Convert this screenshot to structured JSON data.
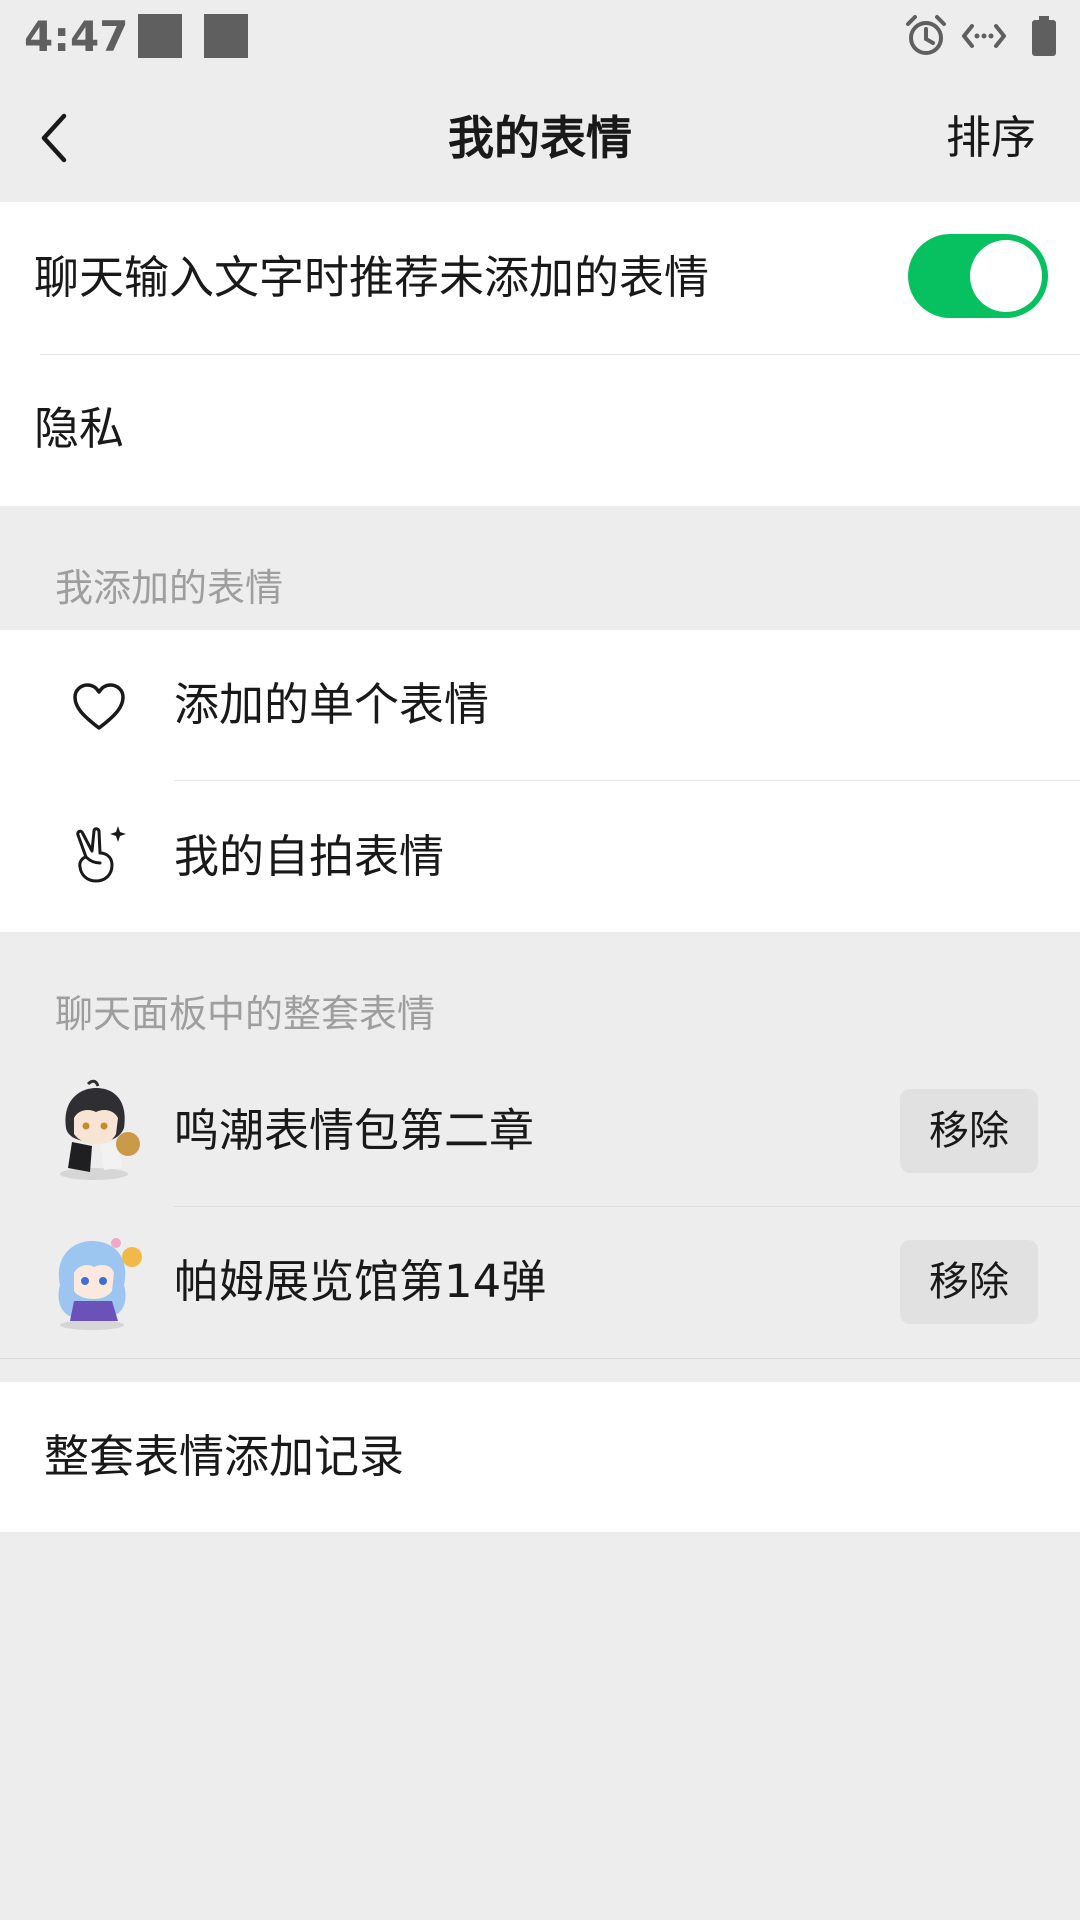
{
  "status_bar": {
    "time": "4:47",
    "icons": [
      "notification-square-icon",
      "notification-square-icon",
      "alarm-icon",
      "data-transfer-icon",
      "battery-icon"
    ]
  },
  "nav": {
    "back_icon": "chevron-left-icon",
    "title": "我的表情",
    "sort_label": "排序"
  },
  "settings": {
    "recommend_label": "聊天输入文字时推荐未添加的表情",
    "recommend_enabled": true,
    "privacy_label": "隐私"
  },
  "added_section": {
    "title": "我添加的表情",
    "items": [
      {
        "icon": "heart-icon",
        "label": "添加的单个表情"
      },
      {
        "icon": "victory-hand-icon",
        "label": "我的自拍表情"
      }
    ]
  },
  "panel_section": {
    "title": "聊天面板中的整套表情",
    "packs": [
      {
        "name": "鸣潮表情包第二章",
        "remove_label": "移除"
      },
      {
        "name": "帕姆展览馆第14弹",
        "remove_label": "移除"
      }
    ]
  },
  "history": {
    "label": "整套表情添加记录"
  },
  "colors": {
    "accent_green": "#07c160",
    "background": "#ededed"
  }
}
